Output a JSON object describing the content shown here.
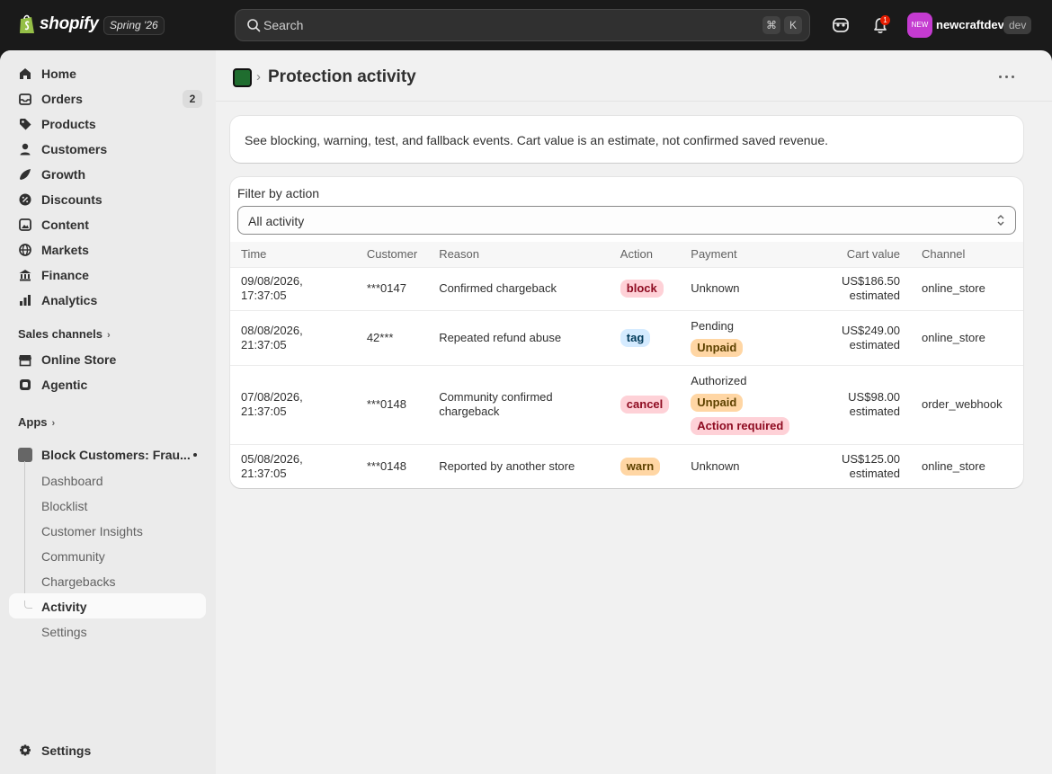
{
  "topbar": {
    "brand": "shopify",
    "version_badge": "Spring '26",
    "search_placeholder": "Search",
    "shortcut_cmd": "⌘",
    "shortcut_key": "K",
    "notification_count": "1",
    "avatar_text": "NEW",
    "account_name": "newcraftdev",
    "account_badge": "dev"
  },
  "sidebar": {
    "items": [
      {
        "label": "Home",
        "icon": "home-icon"
      },
      {
        "label": "Orders",
        "icon": "orders-icon",
        "count": "2"
      },
      {
        "label": "Products",
        "icon": "tag-icon"
      },
      {
        "label": "Customers",
        "icon": "person-icon"
      },
      {
        "label": "Growth",
        "icon": "growth-icon"
      },
      {
        "label": "Discounts",
        "icon": "discount-icon"
      },
      {
        "label": "Content",
        "icon": "content-icon"
      },
      {
        "label": "Markets",
        "icon": "globe-icon"
      },
      {
        "label": "Finance",
        "icon": "bank-icon"
      },
      {
        "label": "Analytics",
        "icon": "chart-icon"
      }
    ],
    "sales_channels_title": "Sales channels",
    "channels": [
      {
        "label": "Online Store",
        "icon": "store-icon"
      },
      {
        "label": "Agentic",
        "icon": "agentic-icon"
      }
    ],
    "apps_title": "Apps",
    "app_name": "Block Customers: Frau...",
    "app_subitems": [
      "Dashboard",
      "Blocklist",
      "Customer Insights",
      "Community",
      "Chargebacks",
      "Activity",
      "Settings"
    ],
    "settings_label": "Settings"
  },
  "page": {
    "title": "Protection activity",
    "info_text": "See blocking, warning, test, and fallback events. Cart value is an estimate, not confirmed saved revenue.",
    "filter_label": "Filter by action",
    "filter_value": "All activity"
  },
  "table": {
    "headers": [
      "Time",
      "Customer",
      "Reason",
      "Action",
      "Payment",
      "Cart value",
      "Channel"
    ],
    "rows": [
      {
        "time_date": "09/08/2026,",
        "time_clock": "17:37:05",
        "customer": "***0147",
        "reason": "Confirmed chargeback",
        "action": "block",
        "payment_status": "Unknown",
        "payment_badges": [],
        "cart_value": "US$186.50",
        "cart_note": "estimated",
        "channel": "online_store"
      },
      {
        "time_date": "08/08/2026,",
        "time_clock": "21:37:05",
        "customer": "42***",
        "reason": "Repeated refund abuse",
        "action": "tag",
        "payment_status": "Pending",
        "payment_badges": [
          "Unpaid"
        ],
        "cart_value": "US$249.00",
        "cart_note": "estimated",
        "channel": "online_store"
      },
      {
        "time_date": "07/08/2026,",
        "time_clock": "21:37:05",
        "customer": "***0148",
        "reason": "Community confirmed chargeback",
        "action": "cancel",
        "payment_status": "Authorized",
        "payment_badges": [
          "Unpaid",
          "Action required"
        ],
        "cart_value": "US$98.00",
        "cart_note": "estimated",
        "channel": "order_webhook"
      },
      {
        "time_date": "05/08/2026,",
        "time_clock": "21:37:05",
        "customer": "***0148",
        "reason": "Reported by another store",
        "action": "warn",
        "payment_status": "Unknown",
        "payment_badges": [],
        "cart_value": "US$125.00",
        "cart_note": "estimated",
        "channel": "online_store"
      }
    ]
  },
  "colors": {
    "topbar_bg": "#1a1a1a",
    "shell_bg": "#f1f1f1",
    "sidebar_bg": "#ebebeb",
    "badge_red": "#fed1d7",
    "badge_blue": "#d5ebff",
    "badge_yellow": "#ffd6a4"
  }
}
